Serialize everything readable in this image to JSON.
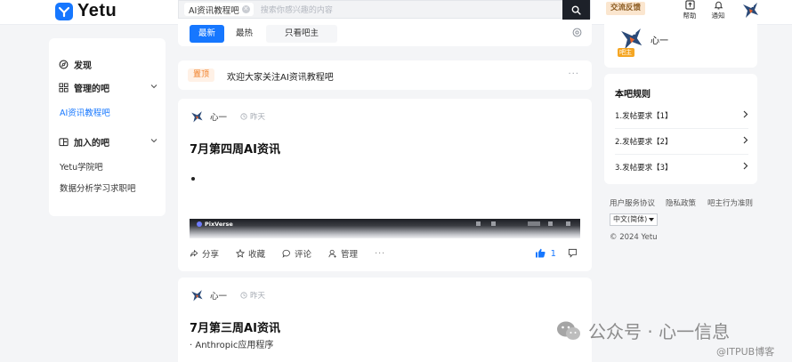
{
  "header": {
    "brand": "Yetu",
    "search_tag": "AI资讯教程吧",
    "search_placeholder": "搜索你感兴趣的内容",
    "feedback_label": "交流反馈",
    "help_label": "帮助",
    "notify_label": "通知"
  },
  "sidebar": {
    "discover_label": "发现",
    "managed_label": "管理的吧",
    "managed_items": [
      "AI资讯教程吧"
    ],
    "joined_label": "加入的吧",
    "joined_items": [
      "Yetu学院吧",
      "数据分析学习求职吧"
    ]
  },
  "tabs": {
    "items": [
      "最新",
      "最热",
      "只看吧主"
    ],
    "active": "最新"
  },
  "notice": {
    "badge": "置顶",
    "text": "欢迎大家关注AI资讯教程吧"
  },
  "posts": [
    {
      "author": "心一",
      "time": "昨天",
      "title": "7月第四周AI资讯",
      "preview_brand": "PixVerse",
      "actions": [
        "分享",
        "收藏",
        "评论",
        "管理"
      ],
      "likes": "1"
    },
    {
      "author": "心一",
      "time": "昨天",
      "title": "7月第三周AI资讯",
      "subline": "· Anthropic应用程序"
    }
  ],
  "owner": {
    "name": "心一",
    "badge": "吧主"
  },
  "rules": {
    "title": "本吧规则",
    "items": [
      "1.发帖要求【1】",
      "2.发帖要求【2】",
      "3.发帖要求【3】"
    ]
  },
  "footer": {
    "links": [
      "用户服务协议",
      "隐私政策",
      "吧主行为准则"
    ],
    "language": "中文(简体)",
    "copyright": "© 2024 Yetu"
  },
  "watermark": {
    "main": "公众号 · 心一信息",
    "sub": "@ITPUB博客"
  },
  "colors": {
    "accent": "#1677ff",
    "pin": "#f07a1f",
    "feedback_bg": "#fbe6cf"
  }
}
